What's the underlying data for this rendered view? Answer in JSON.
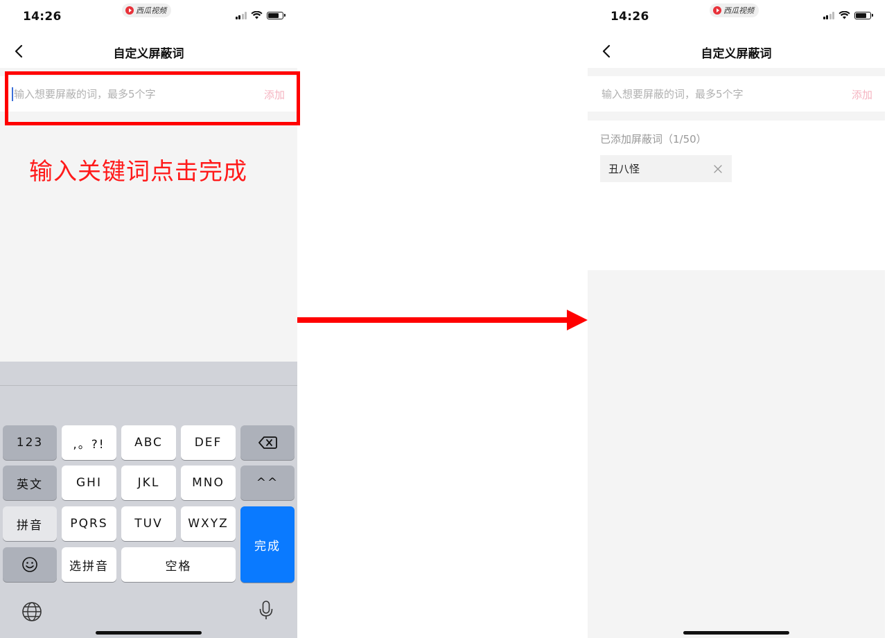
{
  "status": {
    "time": "14:26",
    "app_name": "西瓜视频"
  },
  "left_screen": {
    "nav_title": "自定义屏蔽词",
    "input_placeholder": "输入想要屏蔽的词，最多5个字",
    "add_label": "添加",
    "annotation": "输入关键词点击完成"
  },
  "keyboard": {
    "rows": [
      [
        "123",
        ",。?!",
        "ABC",
        "DEF"
      ],
      [
        "英文",
        "GHI",
        "JKL",
        "MNO",
        "^^"
      ],
      [
        "拼音",
        "PQRS",
        "TUV",
        "WXYZ"
      ],
      [
        "选拼音",
        "空格"
      ]
    ],
    "done_label": "完成",
    "emoji_icon": "smiley-icon",
    "globe_icon": "globe-icon",
    "mic_icon": "microphone-icon",
    "delete_icon": "backspace-icon"
  },
  "right_screen": {
    "nav_title": "自定义屏蔽词",
    "input_placeholder": "输入想要屏蔽的词，最多5个字",
    "add_label": "添加",
    "added_label": "已添加屏蔽词（1/50）",
    "words": [
      "丑八怪"
    ]
  },
  "colors": {
    "accent_red": "#ff0000",
    "add_pink": "#f5b3c0",
    "keyboard_blue": "#0a7aff"
  }
}
